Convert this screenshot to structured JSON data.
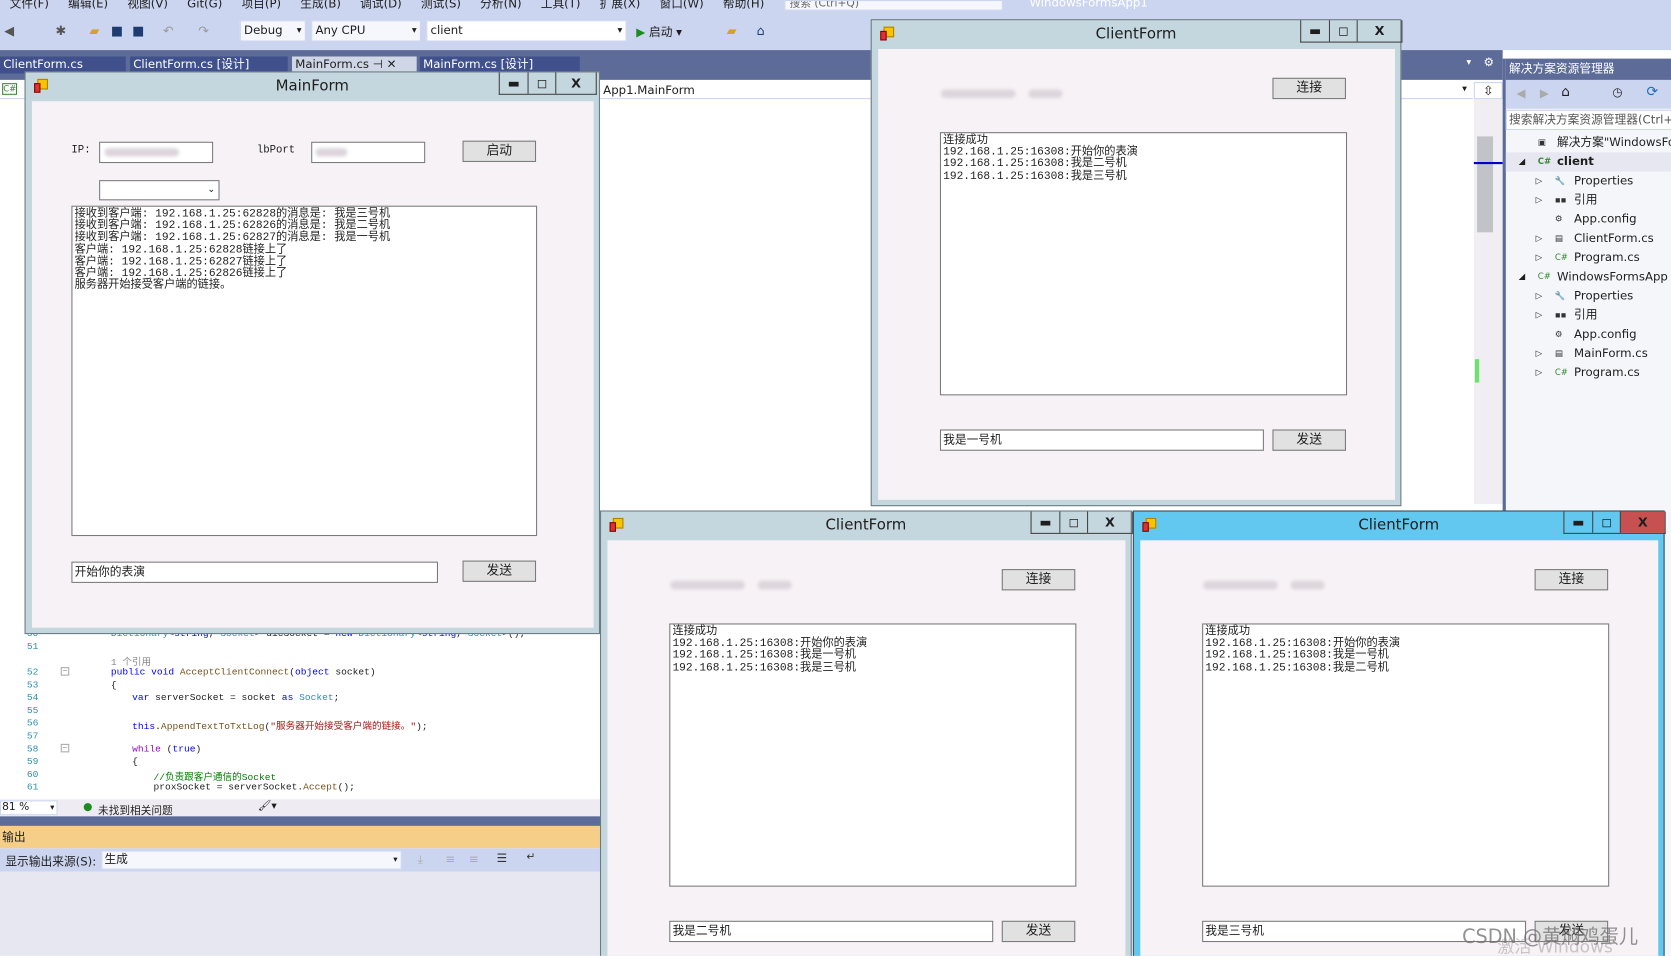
{
  "vs": {
    "menu": [
      "文件(F)",
      "编辑(E)",
      "视图(V)",
      "Git(G)",
      "项目(P)",
      "生成(B)",
      "调试(D)",
      "测试(S)",
      "分析(N)",
      "工具(T)",
      "扩展(X)",
      "窗口(W)",
      "帮助(H)"
    ],
    "search_placeholder": "搜索 (Ctrl+Q)",
    "app_title": "WindowsFormsApp1",
    "toolbar": {
      "config": "Debug",
      "platform": "Any CPU",
      "project": "client",
      "start_label": "启动"
    },
    "tabs": [
      {
        "label": "ClientForm.cs",
        "active": false
      },
      {
        "label": "ClientForm.cs [设计]",
        "active": false
      },
      {
        "label": "MainForm.cs",
        "active": true
      },
      {
        "label": "MainForm.cs [设计]",
        "active": false
      }
    ],
    "nav_member": "App1.MainForm",
    "code": [
      {
        "num": "50",
        "segs": [
          [
            "Dictionary",
            "#2b91af"
          ],
          [
            "<",
            ""
          ],
          [
            "string",
            "#0000ff"
          ],
          [
            ", ",
            ""
          ],
          [
            "Socket",
            "#2b91af"
          ],
          [
            "> dicSocket = ",
            ""
          ],
          [
            "new ",
            "#0000ff"
          ],
          [
            "Dictionary",
            "#2b91af"
          ],
          [
            "<",
            ""
          ],
          [
            "string",
            "#0000ff"
          ],
          [
            ", ",
            ""
          ],
          [
            "Socket",
            "#2b91af"
          ],
          [
            ">();",
            ""
          ]
        ],
        "indent": 0
      },
      {
        "num": "51",
        "segs": [],
        "indent": 0
      },
      {
        "num": "",
        "segs": [
          [
            "1 个引用",
            "#888888"
          ]
        ],
        "indent": 0
      },
      {
        "num": "52",
        "segs": [
          [
            "public void ",
            "#0000ff"
          ],
          [
            "AcceptClientConnect",
            "#74531f"
          ],
          [
            "(",
            ""
          ],
          [
            "object ",
            "#0000ff"
          ],
          [
            "socket)",
            ""
          ]
        ],
        "indent": 0
      },
      {
        "num": "53",
        "segs": [
          [
            "{",
            ""
          ]
        ],
        "indent": 0
      },
      {
        "num": "54",
        "segs": [
          [
            "var ",
            "#0000ff"
          ],
          [
            "serverSocket = socket ",
            ""
          ],
          [
            "as ",
            "#0000ff"
          ],
          [
            "Socket",
            "#2b91af"
          ],
          [
            ";",
            ""
          ]
        ],
        "indent": 1
      },
      {
        "num": "55",
        "segs": [],
        "indent": 1
      },
      {
        "num": "56",
        "segs": [
          [
            "this",
            "#0000ff"
          ],
          [
            ".",
            ""
          ],
          [
            "AppendTextToTxtLog",
            "#74531f"
          ],
          [
            "(",
            ""
          ],
          [
            "\"服务器开始接受客户端的链接。\"",
            "#a31515"
          ],
          [
            ");",
            ""
          ]
        ],
        "indent": 1
      },
      {
        "num": "57",
        "segs": [],
        "indent": 1
      },
      {
        "num": "58",
        "segs": [
          [
            "while ",
            "#8f08c4"
          ],
          [
            "(",
            ""
          ],
          [
            "true",
            "#0000ff"
          ],
          [
            ")",
            ""
          ]
        ],
        "indent": 1
      },
      {
        "num": "59",
        "segs": [
          [
            "{",
            ""
          ]
        ],
        "indent": 1
      },
      {
        "num": "60",
        "segs": [
          [
            "//负责跟客户通信的Socket",
            "#008000"
          ]
        ],
        "indent": 2
      },
      {
        "num": "61",
        "segs": [
          [
            "proxSocket = serverSocket.",
            ""
          ],
          [
            "Accept",
            "#74531f"
          ],
          [
            "();",
            ""
          ]
        ],
        "indent": 2
      }
    ],
    "status": {
      "zoom": "81 %",
      "issues": "未找到相关问题"
    },
    "output": {
      "title": "输出",
      "source_label": "显示输出来源(S):",
      "source_value": "生成"
    },
    "solution_explorer": {
      "title": "解决方案资源管理器",
      "search_placeholder": "搜索解决方案资源管理器(Ctrl+;)",
      "tree": [
        {
          "label": "解决方案\"WindowsForm",
          "level": 0,
          "icon": "solution-icon",
          "expander": ""
        },
        {
          "label": "client",
          "level": 1,
          "icon": "csharp-project-icon",
          "expander": "◢",
          "selected": true
        },
        {
          "label": "Properties",
          "level": 2,
          "icon": "wrench-icon",
          "expander": "▷"
        },
        {
          "label": "引用",
          "level": 2,
          "icon": "references-icon",
          "expander": "▷"
        },
        {
          "label": "App.config",
          "level": 2,
          "icon": "config-file-icon",
          "expander": ""
        },
        {
          "label": "ClientForm.cs",
          "level": 2,
          "icon": "form-icon",
          "expander": "▷"
        },
        {
          "label": "Program.cs",
          "level": 2,
          "icon": "csharp-file-icon",
          "expander": "▷"
        },
        {
          "label": "WindowsFormsApp",
          "level": 1,
          "icon": "csharp-project-icon",
          "expander": "◢"
        },
        {
          "label": "Properties",
          "level": 2,
          "icon": "wrench-icon",
          "expander": "▷"
        },
        {
          "label": "引用",
          "level": 2,
          "icon": "references-icon",
          "expander": "▷"
        },
        {
          "label": "App.config",
          "level": 2,
          "icon": "config-file-icon",
          "expander": ""
        },
        {
          "label": "MainForm.cs",
          "level": 2,
          "icon": "form-icon",
          "expander": "▷"
        },
        {
          "label": "Program.cs",
          "level": 2,
          "icon": "csharp-file-icon",
          "expander": "▷"
        }
      ]
    }
  },
  "main_form": {
    "title": "MainForm",
    "ip_label": "IP:",
    "port_label": "lbPort",
    "start_button": "启动",
    "log": [
      "接收到客户端: 192.168.1.25:62828的消息是: 我是三号机",
      "接收到客户端: 192.168.1.25:62826的消息是: 我是二号机",
      "接收到客户端: 192.168.1.25:62827的消息是: 我是一号机",
      "客户端: 192.168.1.25:62828链接上了",
      "客户端: 192.168.1.25:62827链接上了",
      "客户端: 192.168.1.25:62826链接上了",
      "服务器开始接受客户端的链接。"
    ],
    "message_input": "开始你的表演",
    "send_button": "发送"
  },
  "client_forms": [
    {
      "title": "ClientForm",
      "connect_button": "连接",
      "send_button": "发送",
      "message_input": "我是一号机",
      "log": [
        "连接成功",
        "192.168.1.25:16308:开始你的表演",
        "192.168.1.25:16308:我是二号机",
        "192.168.1.25:16308:我是三号机"
      ]
    },
    {
      "title": "ClientForm",
      "connect_button": "连接",
      "send_button": "发送",
      "message_input": "我是二号机",
      "log": [
        "连接成功",
        "192.168.1.25:16308:开始你的表演",
        "192.168.1.25:16308:我是一号机",
        "192.168.1.25:16308:我是三号机"
      ]
    },
    {
      "title": "ClientForm",
      "connect_button": "连接",
      "send_button": "发送",
      "message_input": "我是三号机",
      "log": [
        "连接成功",
        "192.168.1.25:16308:开始你的表演",
        "192.168.1.25:16308:我是一号机",
        "192.168.1.25:16308:我是二号机"
      ],
      "active": true
    }
  ],
  "watermark": "CSDN @黄焖鸡蛋儿",
  "activation_watermark": "激活 Windows",
  "colors": {
    "active_caption": "#63c8ef",
    "inactive_caption": "#c5d7de",
    "close_hot": "#c75050",
    "output_header": "#f5cf87",
    "vs_chrome": "#5d6b99"
  }
}
